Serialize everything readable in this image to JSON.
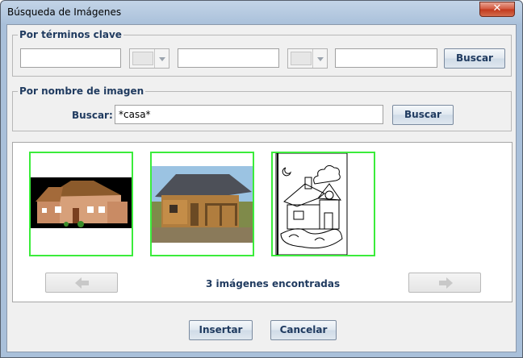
{
  "window": {
    "title": "Búsqueda de Imágenes",
    "close_label": "✕"
  },
  "keywords_group": {
    "title": "Por términos clave",
    "field1_value": "",
    "field2_value": "",
    "field3_value": "",
    "search_label": "Buscar"
  },
  "name_group": {
    "title": "Por nombre de imagen",
    "search_prompt": "Buscar:",
    "query_value": "*casa*",
    "search_label": "Buscar"
  },
  "results": {
    "status": "3 imágenes encontradas",
    "thumbnails": [
      "house-cartoon",
      "log-cabin-photo",
      "house-coloring-drawing"
    ]
  },
  "footer": {
    "insert_label": "Insertar",
    "cancel_label": "Cancelar"
  },
  "colors": {
    "selection_border": "#3bec3b",
    "label_text": "#1f3a5f"
  }
}
